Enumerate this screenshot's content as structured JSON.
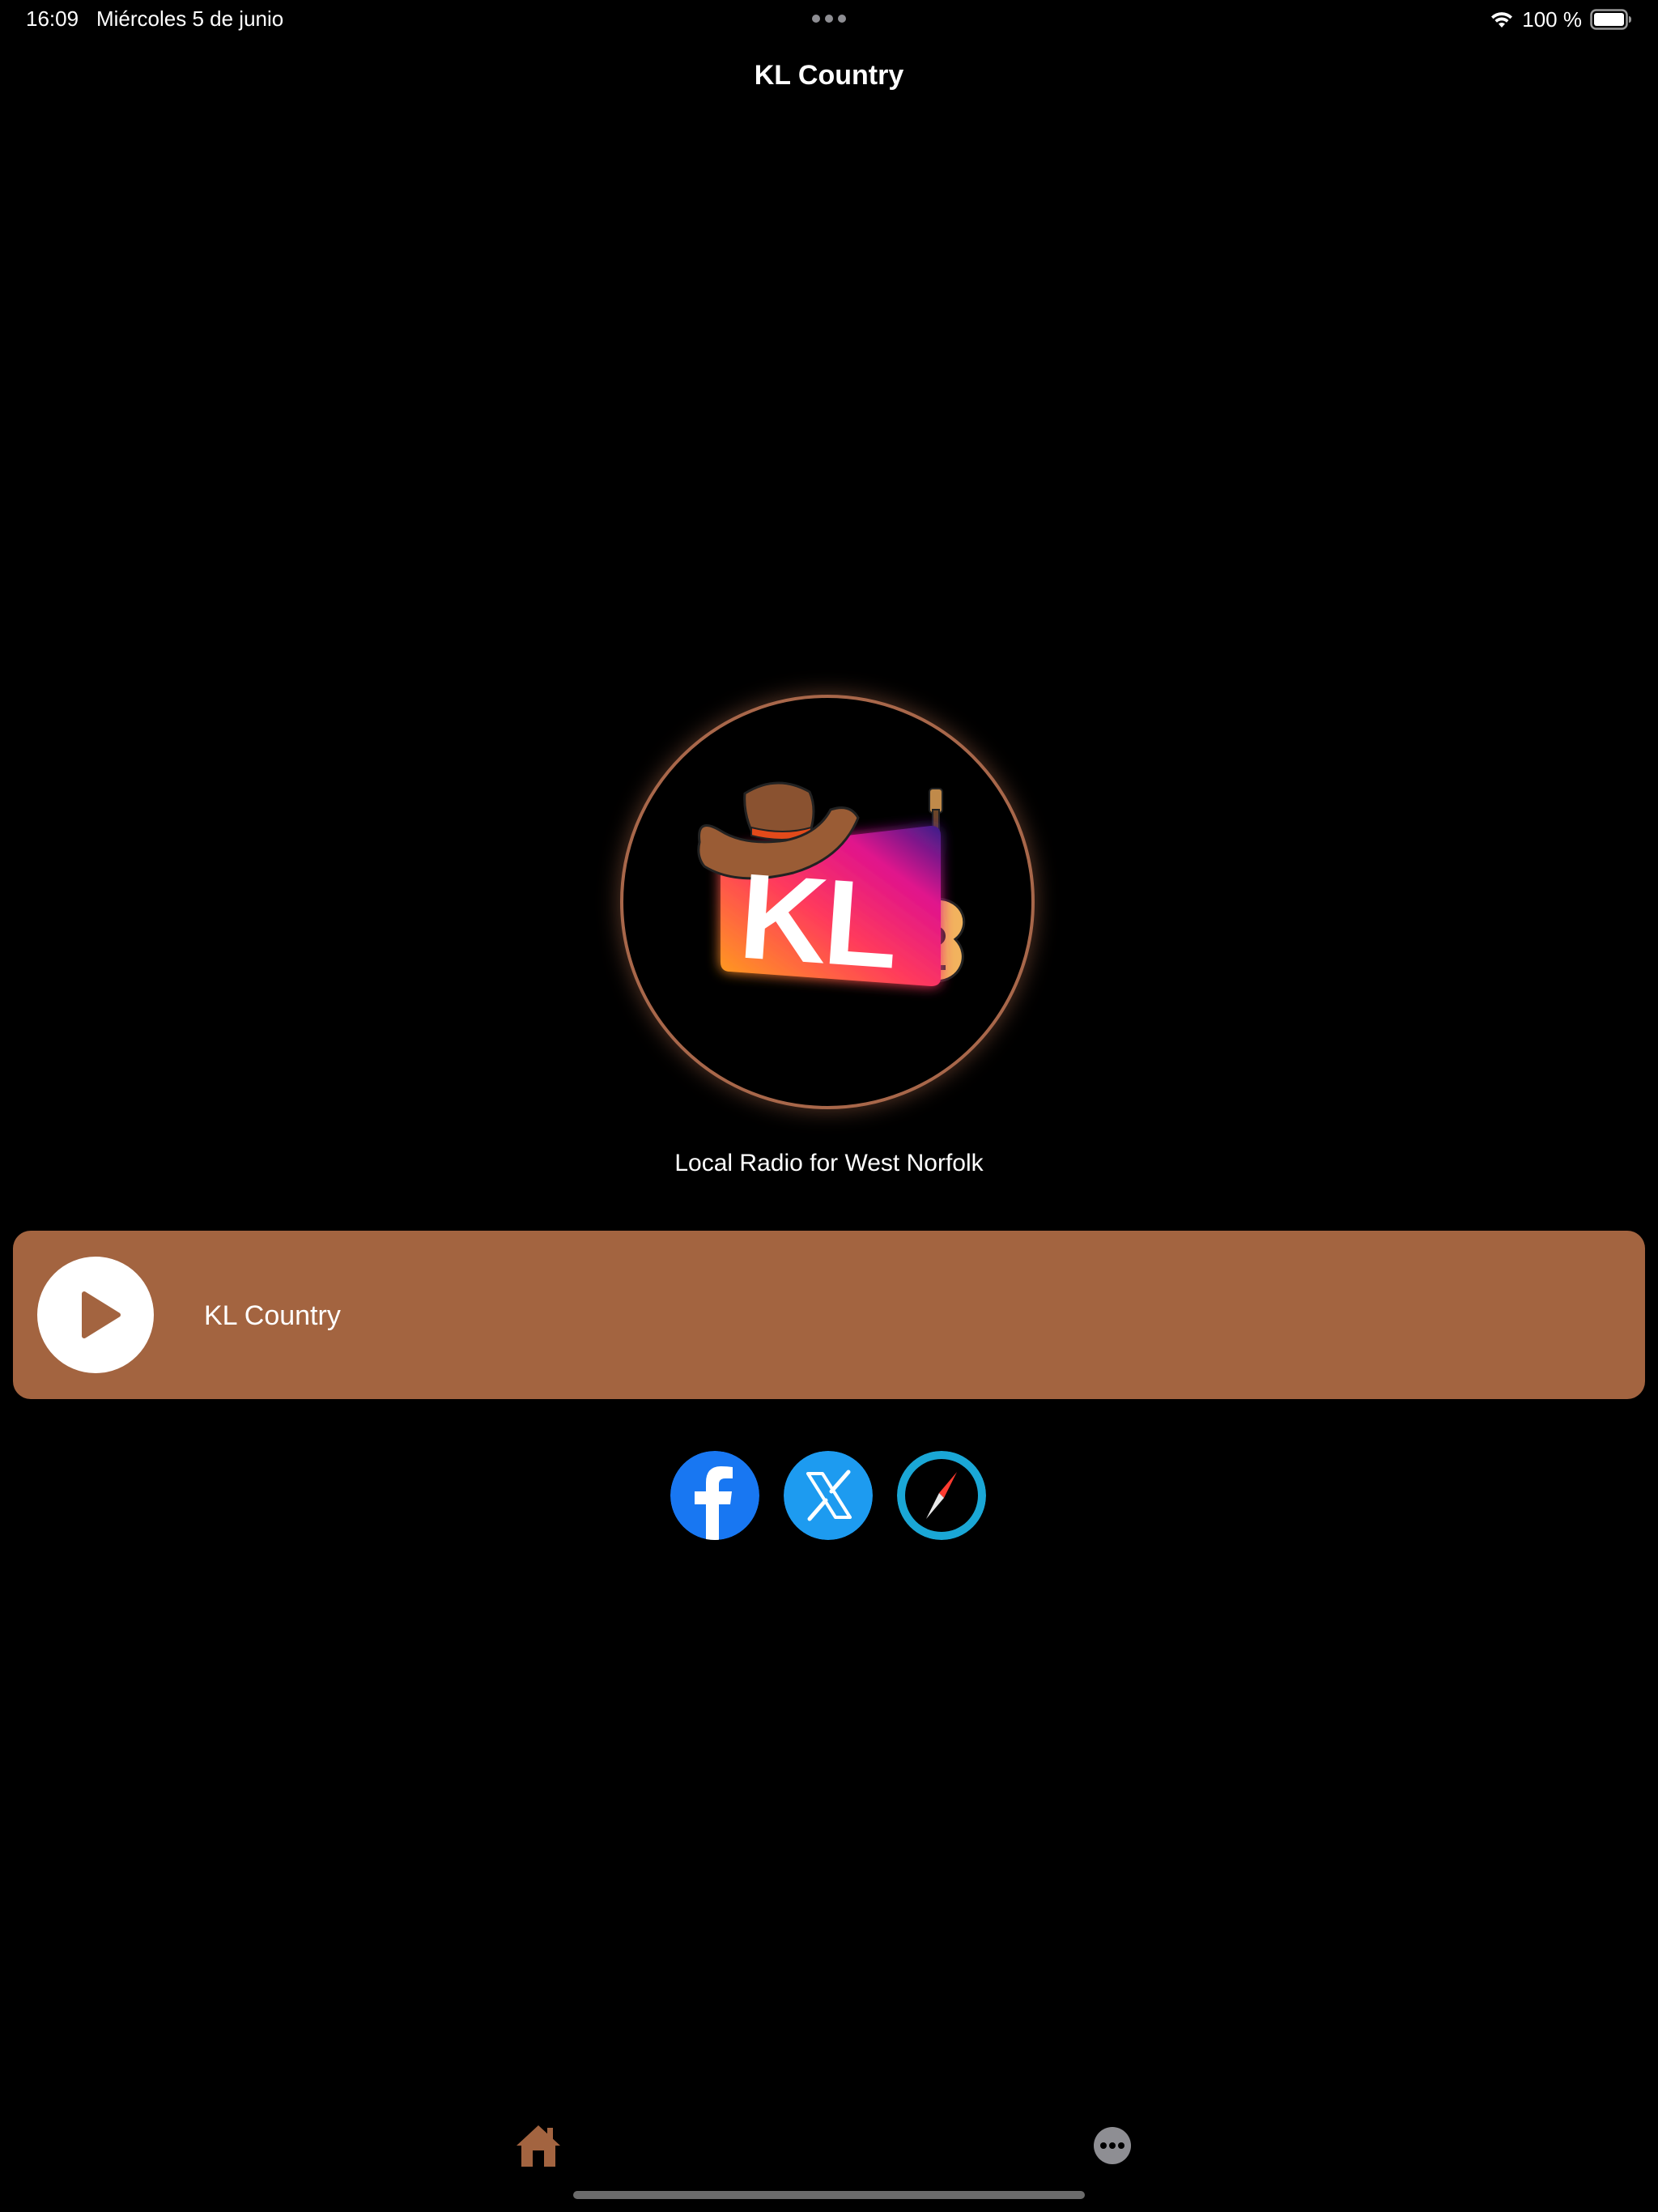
{
  "status_bar": {
    "time": "16:09",
    "date": "Miércoles 5 de junio",
    "battery_label": "100 %",
    "icons": [
      "wifi-icon",
      "battery-icon",
      "multitask-dots-icon"
    ]
  },
  "nav": {
    "title": "KL Country"
  },
  "logo": {
    "letters": "KL",
    "icons": [
      "cowboy-hat-icon",
      "guitar-icon"
    ],
    "ring_color": "#a8674a"
  },
  "tagline": "Local Radio for West Norfolk",
  "player": {
    "station_name": "KL Country",
    "play_icon": "play-icon",
    "bar_color": "#a36440"
  },
  "social": {
    "items": [
      {
        "icon": "facebook-icon",
        "color": "#1877f2"
      },
      {
        "icon": "x-twitter-icon",
        "color": "#1d9bf0"
      },
      {
        "icon": "compass-icon",
        "color": "#1aa7d6"
      }
    ]
  },
  "tab_bar": {
    "items": [
      {
        "icon": "home-icon",
        "color": "#a36440"
      },
      {
        "icon": "more-icon",
        "color": "#8e8e93"
      }
    ]
  }
}
